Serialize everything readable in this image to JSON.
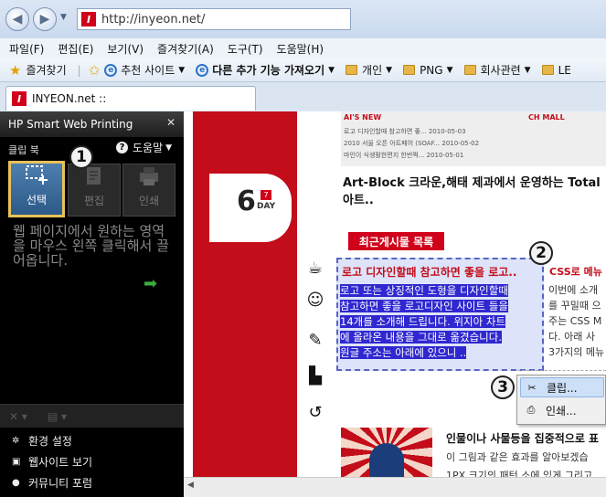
{
  "browser": {
    "url": "http://inyeon.net/",
    "favicon_letter": "I",
    "tab_title": "INYEON.net ::",
    "menu": [
      "파일(F)",
      "편집(E)",
      "보기(V)",
      "즐겨찾기(A)",
      "도구(T)",
      "도움말(H)"
    ],
    "favorites_label": "즐겨찾기",
    "favorites_items": [
      "추천 사이트",
      "다른 추가 기능 가져오기",
      "개인",
      "PNG",
      "회사관련",
      "LE"
    ]
  },
  "panel": {
    "title": "HP Smart Web Printing",
    "clipbook": "클립 북",
    "help": "도움말",
    "tools": {
      "select": "선택",
      "edit": "편집",
      "print": "인쇄"
    },
    "instruction": "웹 페이지에서 원하는 영역을 마우스 왼쪽 클릭해서 끌어옵니다.",
    "links": [
      "환경 설정",
      "웹사이트 보기",
      "커뮤니티 포럼"
    ]
  },
  "badges": [
    "1",
    "2",
    "3"
  ],
  "site": {
    "top_heading_left": "AI'S NEW",
    "top_heading_right": "CH MALL",
    "top_lines": [
      "로고 디자인할때 참고하면 좋...  2010-05-03",
      "2010 서울 오픈 아트페어 (SOAF...  2010-05-02",
      "마인이 식생활한편지 한번쩍...  2010-05-01"
    ],
    "headline": "Art-Block 크라운,해태 제과에서 운영하는 Total아트..",
    "day_number": "6",
    "day_badge": "7",
    "day_label": "DAY",
    "recent_posts_title": "최근게시물 목록",
    "post_title": "로고 디자인할때 참고하면 좋을 로고..",
    "post_lines": [
      "로고 또는 상징적인 도형을 디자인할때",
      "참고하면 좋을 로고디자인 사이트 들을",
      "14개를 소개해 드립니다. 위지아 차트",
      "에 올라온 내용을 그대로 옮겼습니다.",
      "원글 주소는 아래에 있으니 .."
    ],
    "css_title": "CSS로 메뉴",
    "css_lines": [
      "이번에 소개",
      "를 꾸밀때 으",
      "주는 CSS M",
      "다. 아래 사",
      "3가지의 메뉴"
    ],
    "bottom_title": "인물이나 사물등을 집중적으로 표",
    "bottom_text": "이 그림과 같은 효과를 알아보겠습",
    "bottom_text2": "1PX 크기의 패턴 소에 있게 그리고"
  },
  "context_menu": {
    "clip": "클립...",
    "print": "인쇄..."
  }
}
